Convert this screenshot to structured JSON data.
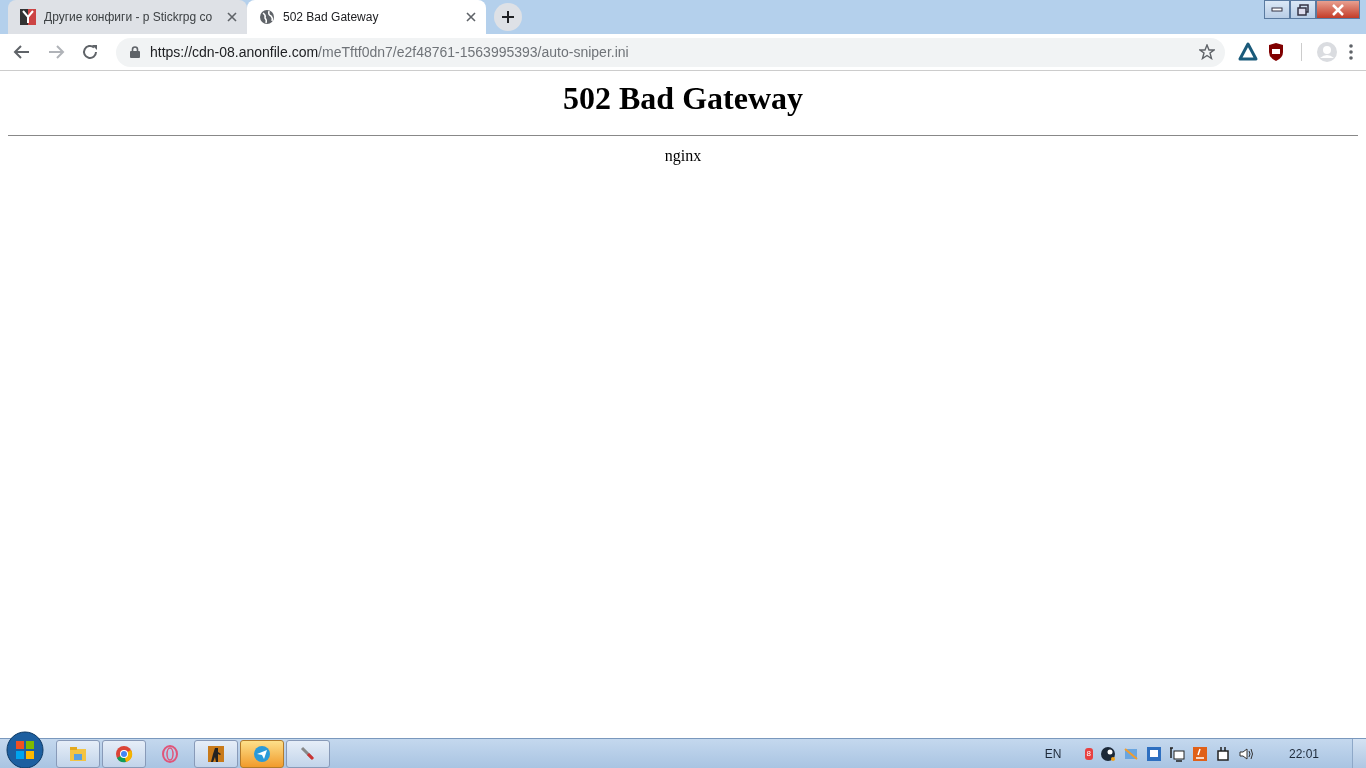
{
  "tabs": [
    {
      "title": "Другие конфиги - р Stickrpg co",
      "selected": false
    },
    {
      "title": "502 Bad Gateway",
      "selected": true
    }
  ],
  "address_bar": {
    "url_host": "https://cdn-08.anonfile.com",
    "url_path": "/meTftf0dn7/e2f48761-1563995393/auto-sniper.ini"
  },
  "page": {
    "heading": "502 Bad Gateway",
    "server": "nginx"
  },
  "taskbar": {
    "items": [
      {
        "running": true,
        "highlighted": false
      },
      {
        "running": true,
        "highlighted": false
      },
      {
        "running": false,
        "highlighted": false
      },
      {
        "running": true,
        "highlighted": false
      },
      {
        "running": true,
        "highlighted": true
      },
      {
        "running": true,
        "highlighted": false
      }
    ],
    "language": "EN",
    "tray_badge": "8",
    "clock": "22:01"
  }
}
